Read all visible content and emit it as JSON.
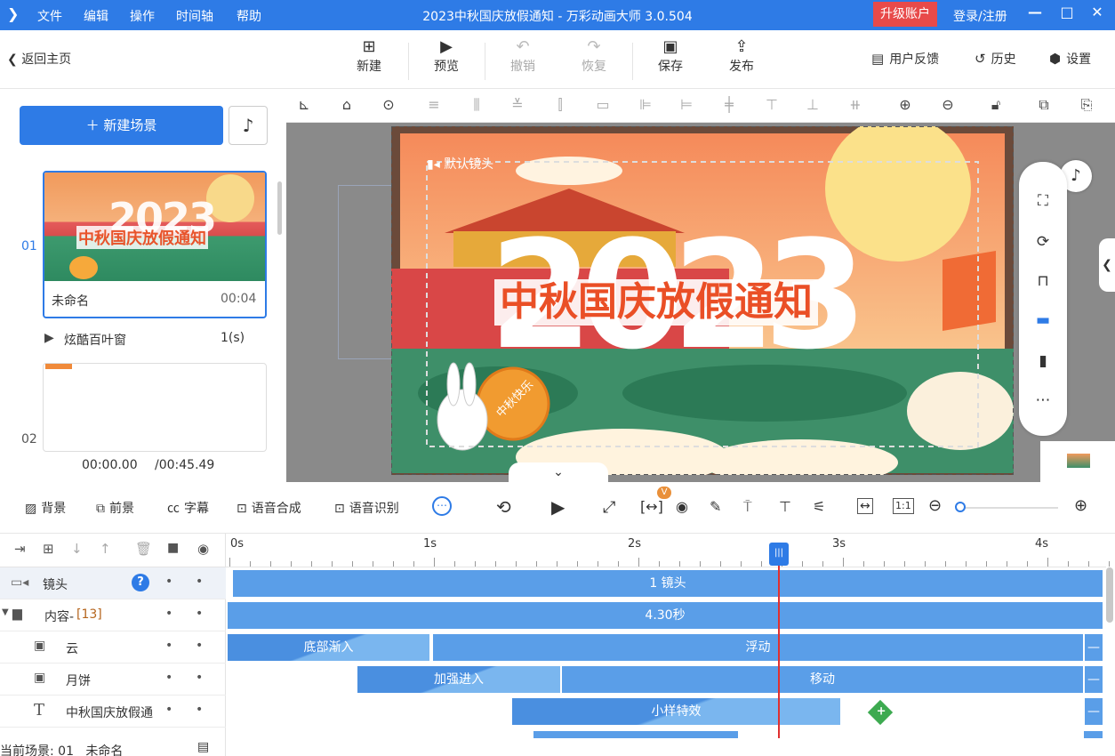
{
  "app": {
    "title": "2023中秋国庆放假通知 - 万彩动画大师 3.0.504",
    "menu": [
      "文件",
      "编辑",
      "操作",
      "时间轴",
      "帮助"
    ],
    "upgrade_label": "升级账户",
    "login_label": "登录/注册"
  },
  "toolbar": {
    "back_label": "返回主页",
    "buttons": [
      {
        "label": "新建",
        "icon": "new-icon",
        "enabled": true
      },
      {
        "label": "预览",
        "icon": "play-icon",
        "enabled": true
      },
      {
        "label": "撤销",
        "icon": "undo-icon",
        "enabled": false
      },
      {
        "label": "恢复",
        "icon": "redo-icon",
        "enabled": false
      },
      {
        "label": "保存",
        "icon": "save-icon",
        "enabled": true
      },
      {
        "label": "发布",
        "icon": "publish-icon",
        "enabled": true
      }
    ],
    "right": [
      "用户反馈",
      "历史",
      "设置"
    ]
  },
  "left_panel": {
    "new_scene_label": "新建场景",
    "scenes": [
      {
        "index": "01",
        "name": "未命名",
        "duration": "00:04",
        "thumb_year": "2023",
        "thumb_title": "中秋国庆放假通知"
      },
      {
        "index": "02"
      }
    ],
    "transition": {
      "name": "炫酷百叶窗",
      "duration": "1(s)"
    },
    "time_current": "00:00.00",
    "time_total": "/00:45.49"
  },
  "canvas": {
    "camera_label": "默认镜头",
    "year": "2023",
    "headline": "中秋国庆放假通知",
    "mooncake_text": "中秋快乐"
  },
  "control_bar": {
    "items": [
      "背景",
      "前景",
      "字幕",
      "语音合成",
      "语音识别"
    ]
  },
  "timeline": {
    "ruler": [
      "0s",
      "1s",
      "2s",
      "3s",
      "4s"
    ],
    "playhead_marker": "|||",
    "rows": [
      {
        "name": "镜头",
        "bars": [
          {
            "label": "1 镜头"
          }
        ]
      },
      {
        "name": "内容-",
        "count": "[13]",
        "bars": [
          {
            "label": "4.30秒"
          }
        ]
      },
      {
        "name": "云",
        "bars": [
          {
            "label": "底部渐入"
          },
          {
            "label": "浮动"
          }
        ]
      },
      {
        "name": "月饼",
        "bars": [
          {
            "label": "加强进入"
          },
          {
            "label": "移动"
          }
        ]
      },
      {
        "name": "中秋国庆放假通",
        "bars": [
          {
            "label": "小样特效"
          }
        ]
      }
    ],
    "status": "当前场景: 01   未命名"
  },
  "colors": {
    "accent": "#2e7be6",
    "upgrade": "#e84a4a",
    "playhead": "#e03030"
  }
}
